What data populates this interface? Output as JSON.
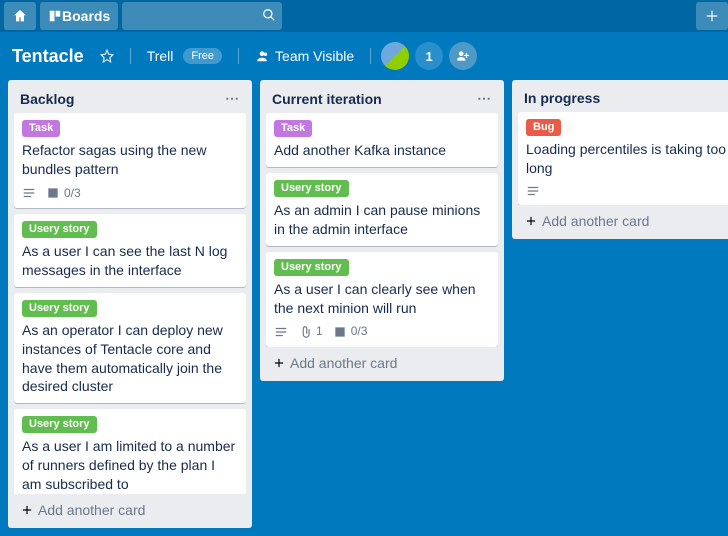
{
  "topbar": {
    "boards_label": "Boards"
  },
  "board_header": {
    "name": "Tentacle",
    "org": "Trell",
    "org_badge": "Free",
    "visibility": "Team Visible",
    "extra_members_count": "1"
  },
  "labels": {
    "task": "Task",
    "story": "Usery story",
    "bug": "Bug"
  },
  "lists": [
    {
      "title": "Backlog",
      "show_menu": true,
      "add_card_label": "Add another card",
      "cards": [
        {
          "label_type": "task",
          "text": "Refactor sagas using the new bundles pattern",
          "badges": {
            "desc": true,
            "checklist": "0/3"
          }
        },
        {
          "label_type": "story",
          "text": "As a user I can see the last N log messages in the interface"
        },
        {
          "label_type": "story",
          "text": "As an operator I can deploy new instances of Tentacle core and have them automatically join the desired cluster"
        },
        {
          "label_type": "story",
          "text": "As a user I am limited to a number of runners defined by the plan I am subscribed to"
        }
      ]
    },
    {
      "title": "Current iteration",
      "show_menu": true,
      "add_card_label": "Add another card",
      "cards": [
        {
          "label_type": "task",
          "text": "Add another Kafka instance"
        },
        {
          "label_type": "story",
          "text": "As an admin I can pause minions in the admin interface"
        },
        {
          "label_type": "story",
          "text": "As a user I can clearly see when the next minion will run",
          "badges": {
            "desc": true,
            "attach": "1",
            "checklist": "0/3"
          }
        }
      ]
    },
    {
      "title": "In progress",
      "show_menu": false,
      "add_card_label": "Add another card",
      "cards": [
        {
          "label_type": "bug",
          "text": "Loading percentiles is taking too long",
          "badges": {
            "desc": true
          }
        }
      ]
    }
  ]
}
